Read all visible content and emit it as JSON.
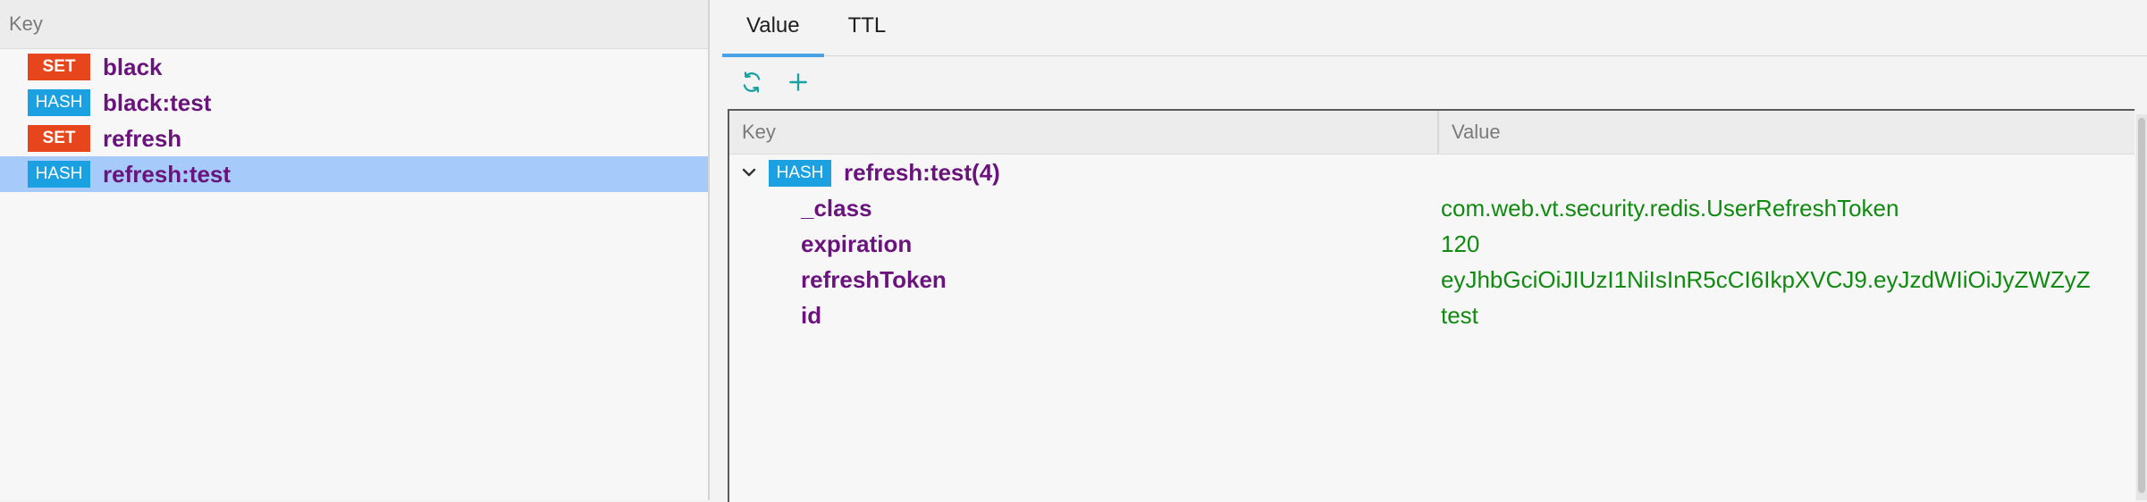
{
  "key_list": {
    "header": "Key",
    "items": [
      {
        "type": "SET",
        "name": "black"
      },
      {
        "type": "HASH",
        "name": "black:test"
      },
      {
        "type": "SET",
        "name": "refresh"
      },
      {
        "type": "HASH",
        "name": "refresh:test"
      }
    ],
    "selected_index": 3
  },
  "tabs": [
    {
      "label": "Value"
    },
    {
      "label": "TTL"
    }
  ],
  "active_tab": "Value",
  "toolbar": {
    "icons": [
      "refresh-icon",
      "add-icon"
    ]
  },
  "value_tree": {
    "columns": {
      "key": "Key",
      "value": "Value"
    },
    "root": {
      "type": "HASH",
      "label": "refresh:test(4)"
    },
    "fields": [
      {
        "name": "_class",
        "value": "com.web.vt.security.redis.UserRefreshToken"
      },
      {
        "name": "expiration",
        "value": "120"
      },
      {
        "name": "refreshToken",
        "value": "eyJhbGciOiJIUzI1NiIsInR5cCI6IkpXVCJ9.eyJzdWIiOiJyZWZyZ"
      },
      {
        "name": "id",
        "value": "test"
      }
    ]
  },
  "colors": {
    "set_badge": "#e7461d",
    "hash_badge": "#1ba1e2",
    "key_text": "#6a137d",
    "value_text": "#108a10",
    "selection": "#a6cbfb",
    "accent": "#4aa3e6"
  }
}
